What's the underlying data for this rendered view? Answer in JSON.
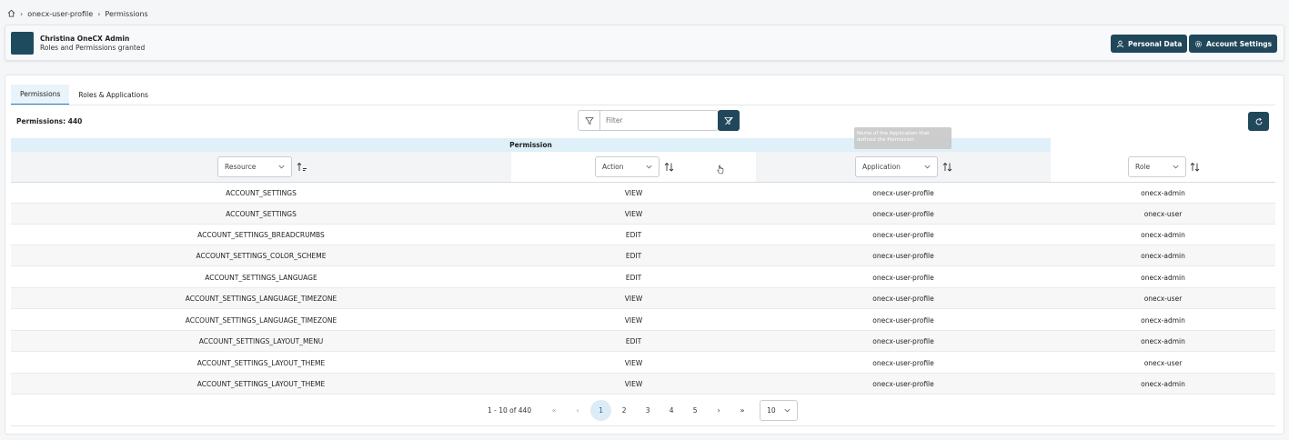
{
  "breadcrumb": {
    "items": [
      "onecx-user-profile",
      "Permissions"
    ]
  },
  "header": {
    "user_name": "Christina OneCX Admin",
    "subtitle": "Roles and Permissions granted",
    "personal_data_label": "Personal Data",
    "account_settings_label": "Account Settings"
  },
  "tabs": [
    {
      "label": "Permissions",
      "active": true
    },
    {
      "label": "Roles & Applications",
      "active": false
    }
  ],
  "toolbar": {
    "count_label": "Permissions: 440",
    "filter_placeholder": "Filter"
  },
  "tooltip": {
    "text": "Name of the Application that defined the Permission"
  },
  "table": {
    "group_header": "Permission",
    "columns": [
      {
        "key": "resource",
        "label": "Resource"
      },
      {
        "key": "action",
        "label": "Action"
      },
      {
        "key": "application",
        "label": "Application"
      },
      {
        "key": "role",
        "label": "Role"
      }
    ],
    "rows": [
      {
        "resource": "ACCOUNT_SETTINGS",
        "action": "VIEW",
        "application": "onecx-user-profile",
        "role": "onecx-admin"
      },
      {
        "resource": "ACCOUNT_SETTINGS",
        "action": "VIEW",
        "application": "onecx-user-profile",
        "role": "onecx-user"
      },
      {
        "resource": "ACCOUNT_SETTINGS_BREADCRUMBS",
        "action": "EDIT",
        "application": "onecx-user-profile",
        "role": "onecx-admin"
      },
      {
        "resource": "ACCOUNT_SETTINGS_COLOR_SCHEME",
        "action": "EDIT",
        "application": "onecx-user-profile",
        "role": "onecx-admin"
      },
      {
        "resource": "ACCOUNT_SETTINGS_LANGUAGE",
        "action": "EDIT",
        "application": "onecx-user-profile",
        "role": "onecx-admin"
      },
      {
        "resource": "ACCOUNT_SETTINGS_LANGUAGE_TIMEZONE",
        "action": "VIEW",
        "application": "onecx-user-profile",
        "role": "onecx-user"
      },
      {
        "resource": "ACCOUNT_SETTINGS_LANGUAGE_TIMEZONE",
        "action": "VIEW",
        "application": "onecx-user-profile",
        "role": "onecx-admin"
      },
      {
        "resource": "ACCOUNT_SETTINGS_LAYOUT_MENU",
        "action": "EDIT",
        "application": "onecx-user-profile",
        "role": "onecx-admin"
      },
      {
        "resource": "ACCOUNT_SETTINGS_LAYOUT_THEME",
        "action": "VIEW",
        "application": "onecx-user-profile",
        "role": "onecx-user"
      },
      {
        "resource": "ACCOUNT_SETTINGS_LAYOUT_THEME",
        "action": "VIEW",
        "application": "onecx-user-profile",
        "role": "onecx-admin"
      }
    ]
  },
  "pagination": {
    "info": "1 - 10 of 440",
    "first": "«",
    "prev": "‹",
    "next": "›",
    "last": "»",
    "pages": [
      "1",
      "2",
      "3",
      "4",
      "5"
    ],
    "current_page": "1",
    "rows_per_page": "10"
  },
  "colors": {
    "primary": "#21485a",
    "accent_light": "#dff0f8",
    "tab_active": "#2a7fb8"
  }
}
